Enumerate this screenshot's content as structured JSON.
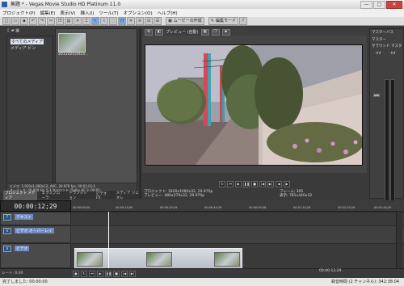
{
  "window": {
    "title": "無題 * - Vegas Movie Studio HD Platinum 11.0",
    "minimize": "—",
    "maximize": "□",
    "close": "✕"
  },
  "menu": [
    "プロジェクト(P)",
    "編集(E)",
    "表示(V)",
    "挿入(I)",
    "ツール(T)",
    "オプション(O)",
    "ヘルプ(H)"
  ],
  "toolbar": {
    "movie_button": "ムービーの作成",
    "edit_mode": "編集モード"
  },
  "project_media": {
    "tree": [
      "すべてのメディア",
      "メディア ビン"
    ],
    "selected": "すべてのメディア",
    "thumb_label": "20110215/023...",
    "properties_line1": "ビデオ: 1,920x1,080x12, AVC, 29.970 fps, 00:01:01;1",
    "properties_line2": "オーディオ: 48,000 Hz, 5.1 サラウンド, Dolby AC-3, 00:01:"
  },
  "left_tabs": [
    "プロジェクト メディア",
    "エクスプローラ",
    "トランジション",
    "ビデオ FX",
    "メディア ジェネレ"
  ],
  "preview": {
    "mode_label": "プレビュー (自動)",
    "project_info": "プロジェクト: 1920x1080x32, 29.970p",
    "preview_info": "プレビュー: 480x270x32, 29.970p",
    "frame_label": "フレーム: 395",
    "display_label": "表示: 781x440x32"
  },
  "mixer": {
    "title": "マスターバス",
    "track_label": "マスター",
    "surround": "サラウンド マスタ",
    "db_top": "-Inf",
    "db_mid": "-Inf"
  },
  "timeline": {
    "timecode": "00:00:12;29",
    "ruler": [
      "00:00:00;00",
      "00:00:15;00",
      "00:00:29;29",
      "00:00:44;29",
      "00:00:59;28",
      "00:01:14;28",
      "00:01:29;29",
      "00:01:44;29"
    ],
    "tracks": [
      {
        "name": "テキスト",
        "icon": "T"
      },
      {
        "name": "ビデオ オーバーレイ",
        "icon": "V"
      },
      {
        "name": "ビデオ",
        "icon": "V"
      }
    ],
    "rate": "レート: 0.00",
    "end_time": "00:00:12;29"
  },
  "status": {
    "left": "完了しました: 00:00:00",
    "right": "録音時間 (2 チャンネル): 342:38:04"
  }
}
